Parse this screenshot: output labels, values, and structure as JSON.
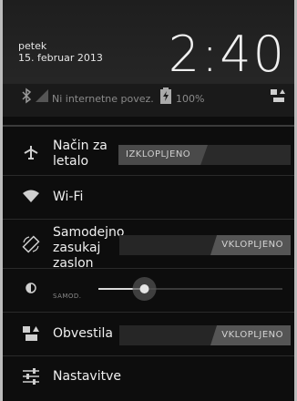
{
  "header": {
    "day": "petek",
    "date": "15. februar 2013",
    "time": "2:40"
  },
  "status": {
    "network_text": "Ni internetne povez.",
    "battery_text": "100%"
  },
  "settings": [
    {
      "label": "Način za letalo",
      "state": "IZKLOPLJENO"
    },
    {
      "label": "Wi-Fi"
    },
    {
      "label": "Samodejno zasukaj zaslon",
      "state": "VKLOPLJENO"
    },
    {
      "brightness_label": "SAMOD.",
      "brightness_level": 0.25
    },
    {
      "label": "Obvestila",
      "state": "VKLOPLJENO"
    },
    {
      "label": "Nastavitve"
    }
  ],
  "colors": {
    "accent": "#2fa5d6"
  },
  "icons": [
    "bluetooth-icon",
    "signal-icon",
    "battery-icon",
    "settings-shortcut-icon",
    "airplane-icon",
    "wifi-icon",
    "rotate-icon",
    "brightness-icon",
    "notifications-icon",
    "settings-icon"
  ]
}
